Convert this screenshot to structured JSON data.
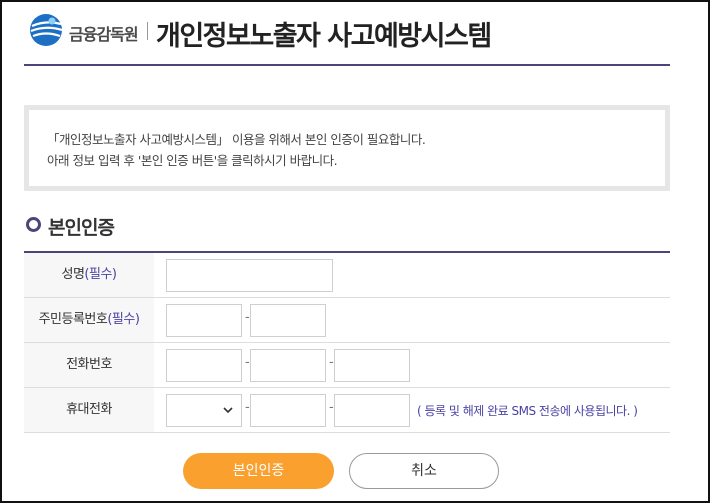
{
  "header": {
    "org_name": "금융감독원",
    "title": "개인정보노출자 사고예방시스템"
  },
  "notice": {
    "line1": "「개인정보노출자 사고예방시스템」 이용을 위해서 본인 인증이 필요합니다.",
    "line2": "아래 정보 입력 후 '본인 인증 버튼'을 클릭하시기 바랍니다."
  },
  "section": {
    "title": "본인인증"
  },
  "form": {
    "required_mark": "(필수)",
    "separator": "-",
    "name_label": "성명",
    "rrn_label": "주민등록번호",
    "phone_label": "전화번호",
    "mobile_label": "휴대전화",
    "mobile_hint": "( 등록 및 해제 완료 SMS 전송에 사용됩니다. )"
  },
  "buttons": {
    "confirm": "본인인증",
    "cancel": "취소"
  },
  "colors": {
    "accent": "#4b4679",
    "button": "#f9a02e",
    "required": "#4a43a3"
  }
}
